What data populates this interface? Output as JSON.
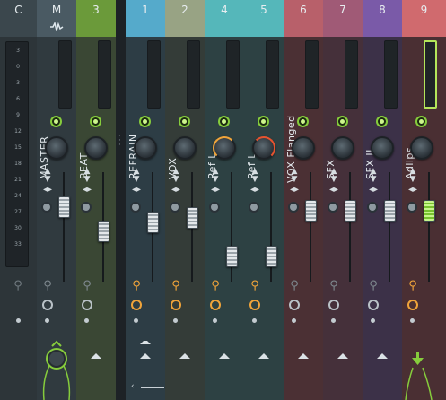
{
  "colors": {
    "green_accent": "#86cc3c",
    "orange_arm": "#f0a43a",
    "pan_left": "#f0a43a",
    "pan_right": "#e6532f"
  },
  "scale": {
    "ticks": [
      "3",
      "0",
      "3",
      "6",
      "9",
      "12",
      "15",
      "18",
      "21",
      "24",
      "27",
      "30",
      "33"
    ]
  },
  "strips": [
    {
      "id": "C",
      "name": "",
      "header": "#3b474d",
      "body": "#2d3539"
    },
    {
      "id": "M",
      "name": "MASTER",
      "header": "#4a5a63",
      "body": "#303a3f"
    },
    {
      "id": "3",
      "name": "BEAT",
      "header": "#6b9a3a",
      "body": "#3a4734"
    },
    {
      "id": "1",
      "name": "REFRAIN",
      "header": "#55aacb",
      "body": "#2d3d45"
    },
    {
      "id": "2",
      "name": "VOX",
      "header": "#98a384",
      "body": "#343c38"
    },
    {
      "id": "4",
      "name": "Ref L",
      "header": "#55b7ba",
      "body": "#2d4143"
    },
    {
      "id": "5",
      "name": "Ref L",
      "header": "#55b7ba",
      "body": "#2d4143"
    },
    {
      "id": "6",
      "name": "VOX Flanged",
      "header": "#b8606a",
      "body": "#4b3034"
    },
    {
      "id": "7",
      "name": "SFX",
      "header": "#a05a76",
      "body": "#45303a"
    },
    {
      "id": "8",
      "name": "SFX II",
      "header": "#7a5aa8",
      "body": "#3c3148"
    },
    {
      "id": "9",
      "name": "Adlips",
      "header": "#d06a6e",
      "body": "#4a2f33"
    }
  ],
  "faders": {
    "M": 0.78,
    "3": 0.52,
    "1": 0.62,
    "2": 0.66,
    "4": 0.25,
    "5": 0.25,
    "6": 0.74,
    "7": 0.74,
    "8": 0.74,
    "9": 0.74
  },
  "icons": {
    "master_header": "waveform-icon",
    "arm": "record-arm-icon",
    "clock": "clock-icon",
    "send": "up-arrow-icon",
    "route": "route-arrow-icon"
  }
}
